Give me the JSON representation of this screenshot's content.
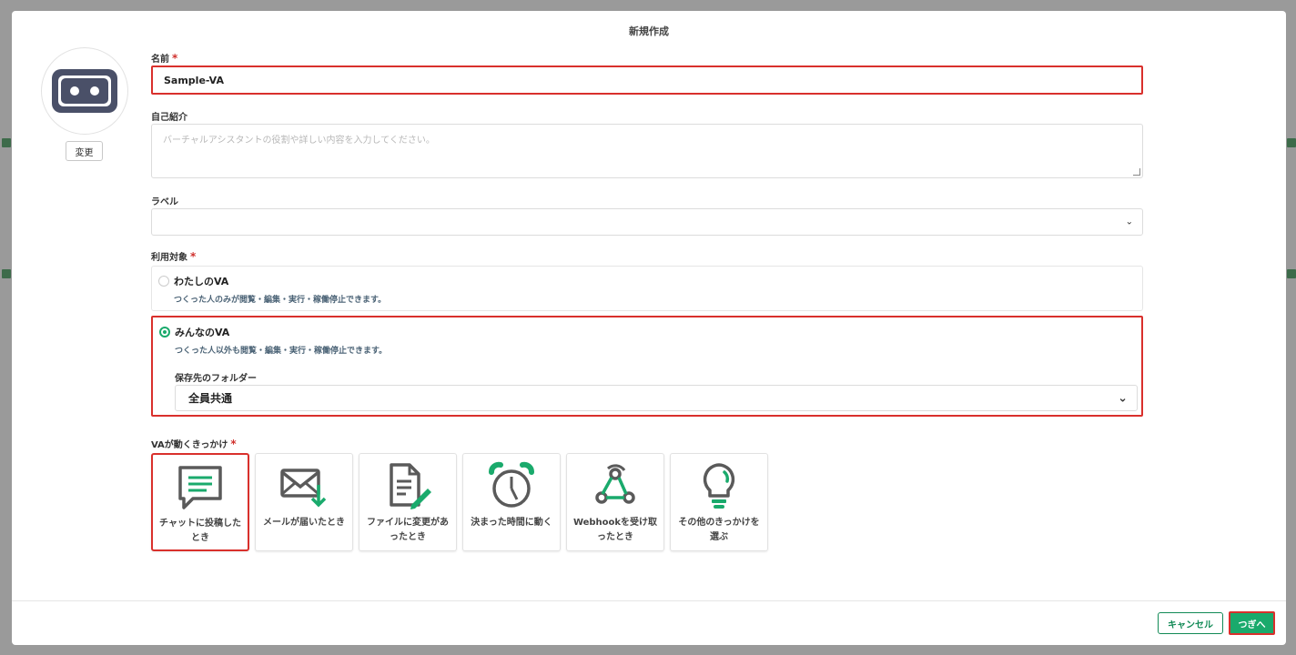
{
  "modal": {
    "title": "新規作成"
  },
  "avatar": {
    "icon": "robot-face-icon",
    "change_label": "変更"
  },
  "name": {
    "label": "名前",
    "required_mark": "*",
    "value": "Sample-VA"
  },
  "intro": {
    "label": "自己紹介",
    "placeholder": "バーチャルアシスタントの役割や詳しい内容を入力してください。"
  },
  "label_field": {
    "label": "ラベル",
    "value": ""
  },
  "audience": {
    "label": "利用対象",
    "required_mark": "*",
    "options": [
      {
        "title": "わたしのVA",
        "desc": "つくった人のみが閲覧・編集・実行・稼働停止できます。",
        "selected": false
      },
      {
        "title": "みんなのVA",
        "desc": "つくった人以外も閲覧・編集・実行・稼働停止できます。",
        "selected": true
      }
    ],
    "folder_label": "保存先のフォルダー",
    "folder_value": "全員共通"
  },
  "triggers": {
    "label": "VAが動くきっかけ",
    "required_mark": "*",
    "items": [
      {
        "label": "チャットに投稿したとき",
        "icon": "chat-bubble-icon",
        "selected": true
      },
      {
        "label": "メールが届いたとき",
        "icon": "mail-download-icon",
        "selected": false
      },
      {
        "label": "ファイルに変更があったとき",
        "icon": "file-edit-icon",
        "selected": false
      },
      {
        "label": "決まった時間に動く",
        "icon": "alarm-clock-icon",
        "selected": false
      },
      {
        "label": "Webhookを受け取ったとき",
        "icon": "webhook-icon",
        "selected": false
      },
      {
        "label": "その他のきっかけを選ぶ",
        "icon": "lightbulb-icon",
        "selected": false
      }
    ]
  },
  "footer": {
    "cancel_label": "キャンセル",
    "next_label": "つぎへ"
  },
  "colors": {
    "accent": "#1aaa6c",
    "highlight": "#d9302c",
    "icon_gray": "#5a5a5a"
  }
}
